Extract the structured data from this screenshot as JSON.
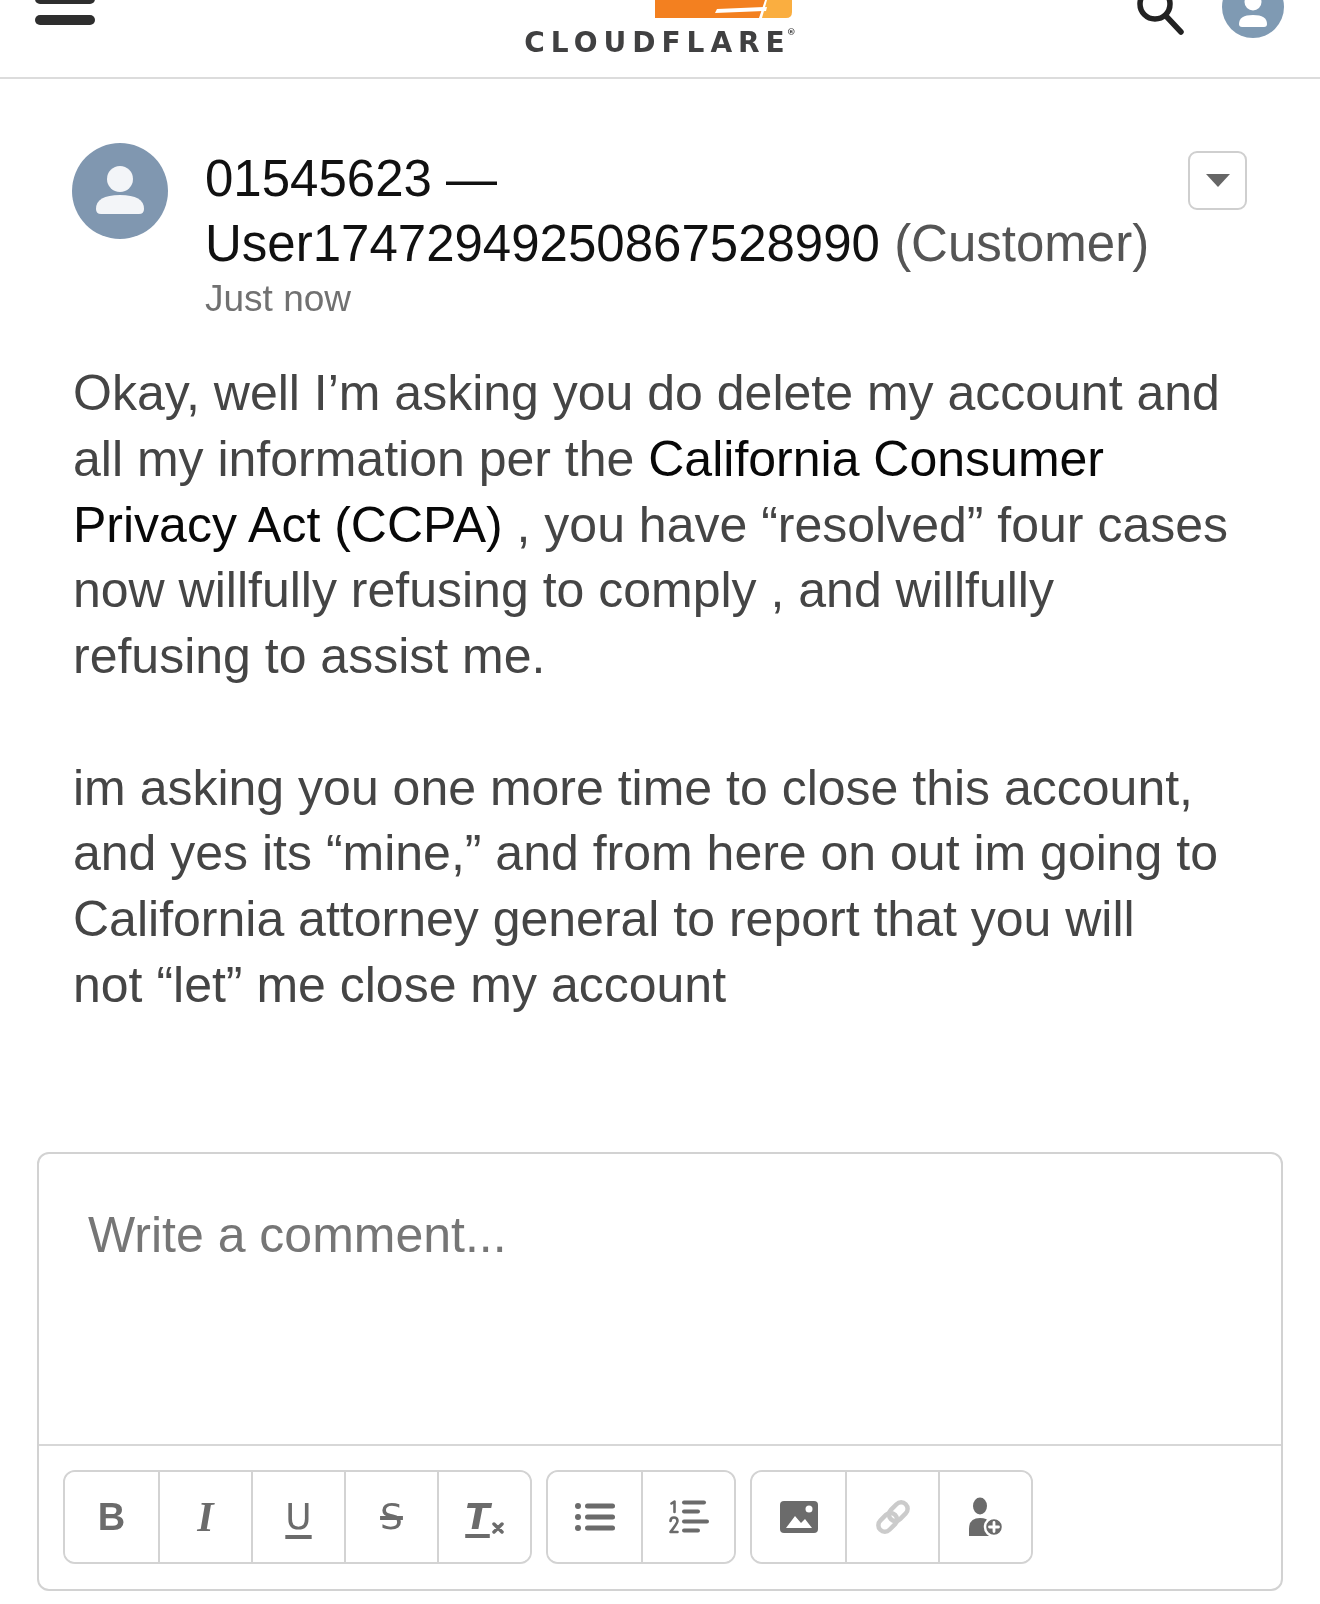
{
  "header": {
    "logo": {
      "text": "CLOUDFLARE",
      "mark": "®"
    }
  },
  "comment": {
    "ticket": "01545623 —",
    "author": "User17472949250867528990",
    "role": "(Customer)",
    "time": "Just now",
    "paragraphs": [
      [
        {
          "kind": "plain",
          "text": "Okay, well I’m asking you do delete my account and\nall my information per the "
        },
        {
          "kind": "highlight",
          "text": "California Consumer\nPrivacy Act (CCPA)"
        },
        {
          "kind": "plain",
          "text": " , you have “resolved” four cases\nnow willfully refusing to comply , and willfully\nrefusing to assist me."
        }
      ],
      [
        {
          "kind": "plain",
          "text": "im asking you one more time to close this account,\nand yes its “mine,” and from here on out im going to\nCalifornia attorney general to report that you will\nnot “let” me close my account"
        }
      ]
    ]
  },
  "editor": {
    "placeholder": "Write a comment...",
    "toolbar": [
      [
        {
          "kind": "bold",
          "label": "B",
          "disabled": false
        },
        {
          "kind": "italic",
          "label": "I",
          "disabled": false
        },
        {
          "kind": "underline",
          "label": "U",
          "disabled": false
        },
        {
          "kind": "strikethrough",
          "label": "S",
          "disabled": false
        },
        {
          "kind": "clear_format",
          "label": "T",
          "disabled": false
        }
      ],
      [
        {
          "kind": "bullet_list",
          "disabled": false
        },
        {
          "kind": "numbered_list",
          "disabled": false
        }
      ],
      [
        {
          "kind": "image",
          "disabled": false
        },
        {
          "kind": "link",
          "disabled": true
        },
        {
          "kind": "mention",
          "disabled": false
        }
      ]
    ]
  }
}
